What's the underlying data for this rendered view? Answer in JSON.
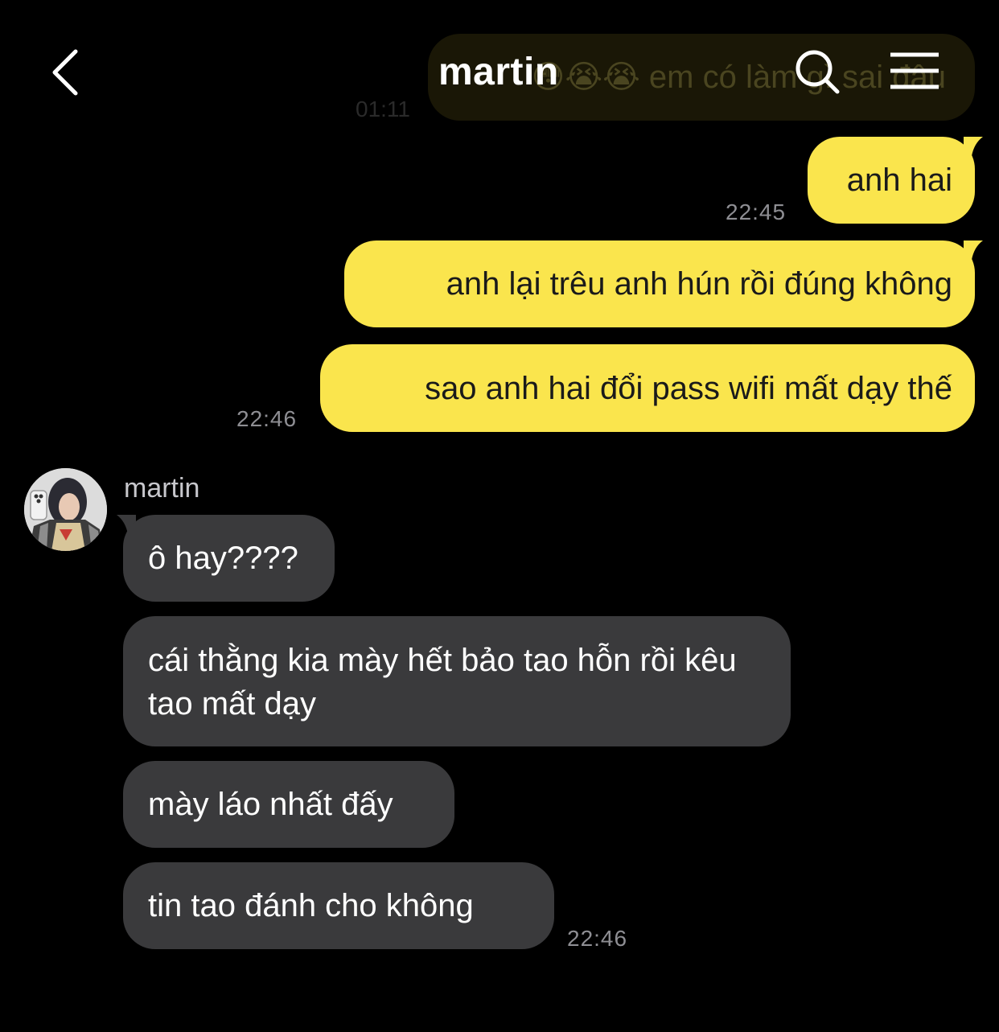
{
  "header": {
    "title": "martin",
    "back_icon": "chevron-left-icon",
    "search_icon": "search-icon",
    "menu_icon": "hamburger-menu-icon"
  },
  "ghost": {
    "text": "😳😭😭 em có làm gì sai đâu",
    "time": "01:11"
  },
  "outgoing": [
    {
      "text": "anh hai",
      "time": "22:45"
    },
    {
      "text": "anh lại trêu anh hún rồi đúng không",
      "time": ""
    },
    {
      "text": "sao anh hai đổi pass wifi mất dạy thế",
      "time": "22:46"
    }
  ],
  "incoming": {
    "sender": "martin",
    "messages": [
      {
        "text": "ô hay????"
      },
      {
        "text": "cái thằng kia mày hết bảo tao hỗn rồi kêu tao mất dạy"
      },
      {
        "text": "mày láo nhất đấy"
      },
      {
        "text": "tin tao đánh cho không",
        "time": "22:46"
      }
    ]
  },
  "colors": {
    "background": "#000000",
    "outgoing_bubble": "#fae54d",
    "incoming_bubble": "#3a3a3c",
    "timestamp": "#8e8e93"
  }
}
